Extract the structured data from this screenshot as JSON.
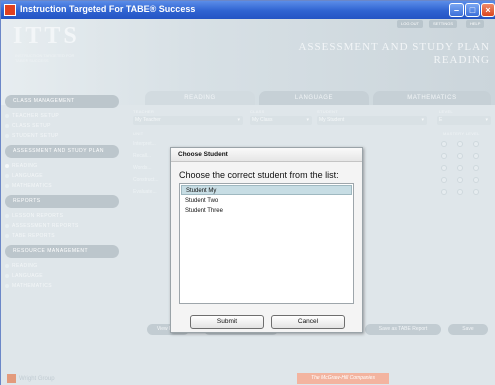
{
  "window": {
    "title": "Instruction Targeted For TABE® Success",
    "min_glyph": "–",
    "max_glyph": "□",
    "close_glyph": "×"
  },
  "header": {
    "logo": "ITTS",
    "logo_sub": "INSTRUCTION TARGETED FOR TABE® SUCCESS",
    "links": [
      "LOG OUT",
      "SETTINGS",
      "HELP"
    ],
    "page_title": "ASSESSMENT AND STUDY PLAN",
    "page_subtitle": "READING"
  },
  "sidebar": {
    "sections": [
      {
        "heading": "CLASS MANAGEMENT",
        "items": [
          "TEACHER SETUP",
          "CLASS SETUP",
          "STUDENT SETUP"
        ]
      },
      {
        "heading": "ASSESSMENT AND STUDY PLAN",
        "items": [
          "READING",
          "LANGUAGE",
          "MATHEMATICS"
        ]
      },
      {
        "heading": "REPORTS",
        "items": [
          "LESSON REPORTS",
          "ASSESSMENT REPORTS",
          "TABE REPORTS"
        ]
      },
      {
        "heading": "RESOURCE MANAGEMENT",
        "items": [
          "READING",
          "LANGUAGE",
          "MATHEMATICS"
        ]
      }
    ]
  },
  "main": {
    "tabs": [
      "READING",
      "LANGUAGE",
      "MATHEMATICS"
    ],
    "fields": {
      "teacher_label": "TEACHER",
      "teacher_value": "My Teacher",
      "class_label": "CLASS",
      "class_value": "My Class",
      "student_label": "STUDENT",
      "student_value": "My Student",
      "level_label": "LEVEL",
      "level_value": "E"
    },
    "unit_label": "UNIT",
    "mastery_label": "MASTERY LEVEL",
    "units": [
      "Interpret...",
      "Recall...",
      "Words...",
      "Construct...",
      "Evaluate..."
    ],
    "bottom_buttons": [
      "View Plan",
      "Import TABE Session",
      "Save as TABE Report",
      "Save"
    ]
  },
  "footer": {
    "brand": "Wright Group",
    "publisher": "The McGraw-Hill Companies"
  },
  "modal": {
    "title": "Choose Student",
    "prompt": "Choose the correct student from the list:",
    "students": [
      "Student My",
      "Student Two",
      "Student Three"
    ],
    "selected_index": 0,
    "submit_label": "Submit",
    "cancel_label": "Cancel"
  }
}
